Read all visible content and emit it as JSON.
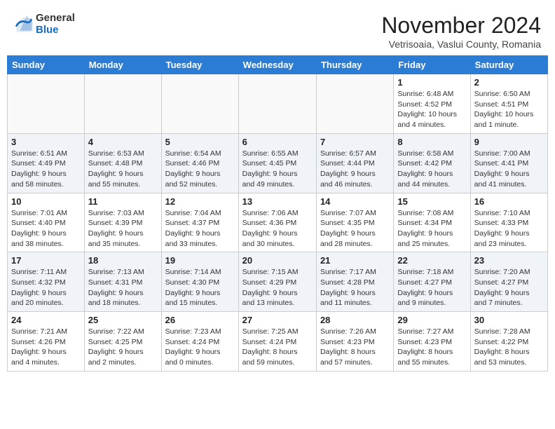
{
  "header": {
    "logo_general": "General",
    "logo_blue": "Blue",
    "month_title": "November 2024",
    "location": "Vetrisoaia, Vaslui County, Romania"
  },
  "weekdays": [
    "Sunday",
    "Monday",
    "Tuesday",
    "Wednesday",
    "Thursday",
    "Friday",
    "Saturday"
  ],
  "weeks": [
    [
      {
        "day": "",
        "info": ""
      },
      {
        "day": "",
        "info": ""
      },
      {
        "day": "",
        "info": ""
      },
      {
        "day": "",
        "info": ""
      },
      {
        "day": "",
        "info": ""
      },
      {
        "day": "1",
        "info": "Sunrise: 6:48 AM\nSunset: 4:52 PM\nDaylight: 10 hours\nand 4 minutes."
      },
      {
        "day": "2",
        "info": "Sunrise: 6:50 AM\nSunset: 4:51 PM\nDaylight: 10 hours\nand 1 minute."
      }
    ],
    [
      {
        "day": "3",
        "info": "Sunrise: 6:51 AM\nSunset: 4:49 PM\nDaylight: 9 hours\nand 58 minutes."
      },
      {
        "day": "4",
        "info": "Sunrise: 6:53 AM\nSunset: 4:48 PM\nDaylight: 9 hours\nand 55 minutes."
      },
      {
        "day": "5",
        "info": "Sunrise: 6:54 AM\nSunset: 4:46 PM\nDaylight: 9 hours\nand 52 minutes."
      },
      {
        "day": "6",
        "info": "Sunrise: 6:55 AM\nSunset: 4:45 PM\nDaylight: 9 hours\nand 49 minutes."
      },
      {
        "day": "7",
        "info": "Sunrise: 6:57 AM\nSunset: 4:44 PM\nDaylight: 9 hours\nand 46 minutes."
      },
      {
        "day": "8",
        "info": "Sunrise: 6:58 AM\nSunset: 4:42 PM\nDaylight: 9 hours\nand 44 minutes."
      },
      {
        "day": "9",
        "info": "Sunrise: 7:00 AM\nSunset: 4:41 PM\nDaylight: 9 hours\nand 41 minutes."
      }
    ],
    [
      {
        "day": "10",
        "info": "Sunrise: 7:01 AM\nSunset: 4:40 PM\nDaylight: 9 hours\nand 38 minutes."
      },
      {
        "day": "11",
        "info": "Sunrise: 7:03 AM\nSunset: 4:39 PM\nDaylight: 9 hours\nand 35 minutes."
      },
      {
        "day": "12",
        "info": "Sunrise: 7:04 AM\nSunset: 4:37 PM\nDaylight: 9 hours\nand 33 minutes."
      },
      {
        "day": "13",
        "info": "Sunrise: 7:06 AM\nSunset: 4:36 PM\nDaylight: 9 hours\nand 30 minutes."
      },
      {
        "day": "14",
        "info": "Sunrise: 7:07 AM\nSunset: 4:35 PM\nDaylight: 9 hours\nand 28 minutes."
      },
      {
        "day": "15",
        "info": "Sunrise: 7:08 AM\nSunset: 4:34 PM\nDaylight: 9 hours\nand 25 minutes."
      },
      {
        "day": "16",
        "info": "Sunrise: 7:10 AM\nSunset: 4:33 PM\nDaylight: 9 hours\nand 23 minutes."
      }
    ],
    [
      {
        "day": "17",
        "info": "Sunrise: 7:11 AM\nSunset: 4:32 PM\nDaylight: 9 hours\nand 20 minutes."
      },
      {
        "day": "18",
        "info": "Sunrise: 7:13 AM\nSunset: 4:31 PM\nDaylight: 9 hours\nand 18 minutes."
      },
      {
        "day": "19",
        "info": "Sunrise: 7:14 AM\nSunset: 4:30 PM\nDaylight: 9 hours\nand 15 minutes."
      },
      {
        "day": "20",
        "info": "Sunrise: 7:15 AM\nSunset: 4:29 PM\nDaylight: 9 hours\nand 13 minutes."
      },
      {
        "day": "21",
        "info": "Sunrise: 7:17 AM\nSunset: 4:28 PM\nDaylight: 9 hours\nand 11 minutes."
      },
      {
        "day": "22",
        "info": "Sunrise: 7:18 AM\nSunset: 4:27 PM\nDaylight: 9 hours\nand 9 minutes."
      },
      {
        "day": "23",
        "info": "Sunrise: 7:20 AM\nSunset: 4:27 PM\nDaylight: 9 hours\nand 7 minutes."
      }
    ],
    [
      {
        "day": "24",
        "info": "Sunrise: 7:21 AM\nSunset: 4:26 PM\nDaylight: 9 hours\nand 4 minutes."
      },
      {
        "day": "25",
        "info": "Sunrise: 7:22 AM\nSunset: 4:25 PM\nDaylight: 9 hours\nand 2 minutes."
      },
      {
        "day": "26",
        "info": "Sunrise: 7:23 AM\nSunset: 4:24 PM\nDaylight: 9 hours\nand 0 minutes."
      },
      {
        "day": "27",
        "info": "Sunrise: 7:25 AM\nSunset: 4:24 PM\nDaylight: 8 hours\nand 59 minutes."
      },
      {
        "day": "28",
        "info": "Sunrise: 7:26 AM\nSunset: 4:23 PM\nDaylight: 8 hours\nand 57 minutes."
      },
      {
        "day": "29",
        "info": "Sunrise: 7:27 AM\nSunset: 4:23 PM\nDaylight: 8 hours\nand 55 minutes."
      },
      {
        "day": "30",
        "info": "Sunrise: 7:28 AM\nSunset: 4:22 PM\nDaylight: 8 hours\nand 53 minutes."
      }
    ]
  ]
}
